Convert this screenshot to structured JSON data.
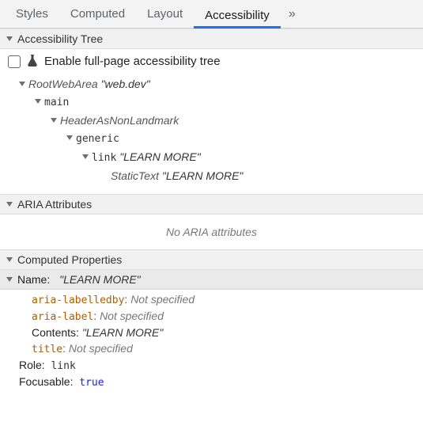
{
  "tabs": {
    "items": [
      "Styles",
      "Computed",
      "Layout",
      "Accessibility"
    ],
    "active_index": 3
  },
  "sections": {
    "tree_header": "Accessibility Tree",
    "aria_header": "ARIA Attributes",
    "computed_header": "Computed Properties"
  },
  "enable_label": "Enable full-page accessibility tree",
  "tree": {
    "n0_role": "RootWebArea",
    "n0_name": "\"web.dev\"",
    "n1_role": "main",
    "n2_role": "HeaderAsNonLandmark",
    "n3_role": "generic",
    "n4_role": "link",
    "n4_name": "\"LEARN MORE\"",
    "n5_role": "StaticText",
    "n5_name": "\"LEARN MORE\""
  },
  "aria_empty": "No ARIA attributes",
  "computed": {
    "name_label": "Name:",
    "name_value": "\"LEARN MORE\"",
    "rows": [
      {
        "attr": "aria-labelledby",
        "value": "Not specified",
        "kind": "notspec"
      },
      {
        "attr": "aria-label",
        "value": "Not specified",
        "kind": "notspec"
      },
      {
        "attr": "Contents",
        "value": "\"LEARN MORE\"",
        "kind": "quoted",
        "plain": true
      },
      {
        "attr": "title",
        "value": "Not specified",
        "kind": "notspec"
      }
    ],
    "role_label": "Role:",
    "role_value": "link",
    "focusable_label": "Focusable:",
    "focusable_value": "true"
  }
}
